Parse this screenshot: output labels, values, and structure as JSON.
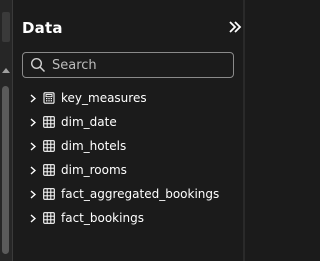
{
  "panel": {
    "title": "Data"
  },
  "search": {
    "placeholder": "Search",
    "value": ""
  },
  "tables": [
    {
      "label": "key_measures",
      "icon": "measure-table-icon"
    },
    {
      "label": "dim_date",
      "icon": "table-icon"
    },
    {
      "label": "dim_hotels",
      "icon": "table-icon"
    },
    {
      "label": "dim_rooms",
      "icon": "table-icon"
    },
    {
      "label": "fact_aggregated_bookings",
      "icon": "table-icon"
    },
    {
      "label": "fact_bookings",
      "icon": "table-icon"
    }
  ],
  "colors": {
    "background": "#1b1b1b",
    "text": "#ffffff",
    "border": "#8a8a8a",
    "scroll_thumb": "#5a5a5a"
  }
}
